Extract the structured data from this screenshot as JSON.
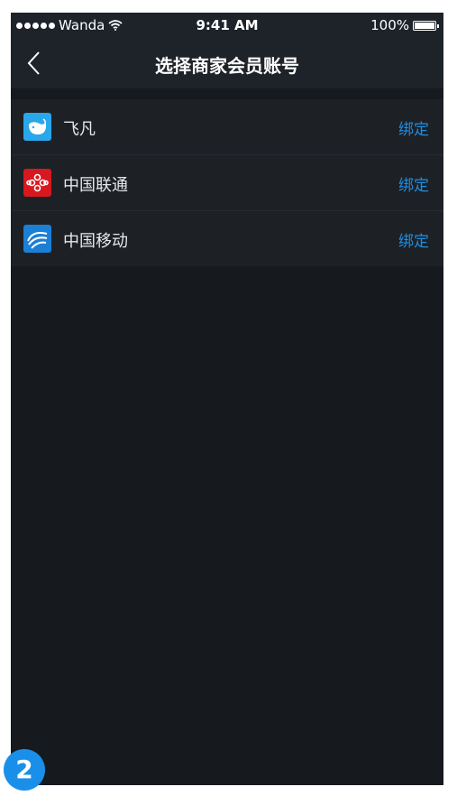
{
  "status_bar": {
    "carrier": "Wanda",
    "time": "9:41 AM",
    "battery": "100%",
    "battery_level": 1.0
  },
  "nav": {
    "title": "选择商家会员账号"
  },
  "accounts": [
    {
      "name": "飞凡",
      "action": "绑定",
      "icon": "feifan-whale-icon",
      "color": "#29a7ea"
    },
    {
      "name": "中国联通",
      "action": "绑定",
      "icon": "china-unicom-knot-icon",
      "color": "#d7191f"
    },
    {
      "name": "中国移动",
      "action": "绑定",
      "icon": "china-mobile-swirl-icon",
      "color": "#1c7fd6"
    }
  ],
  "step_badge": "2",
  "colors": {
    "accent": "#1f8ee0",
    "touch_highlight": "#1d6b3e",
    "background": "#16191d"
  }
}
